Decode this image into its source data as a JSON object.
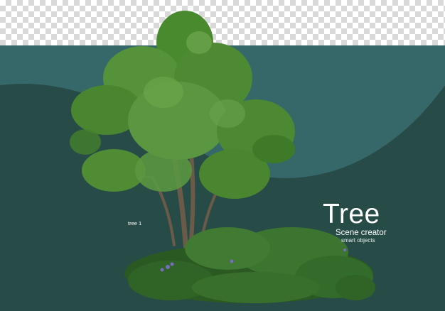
{
  "title": "Tree",
  "subtitle": "Scene creator",
  "tagline": "smart objects",
  "object_label": "tree 1",
  "colors": {
    "teal_light": "#376869",
    "teal_dark": "#274c48",
    "foliage": "#4e8a33",
    "shrub": "#2f6426"
  },
  "icons": [
    "tree-illustration",
    "shrub-bed-illustration"
  ]
}
